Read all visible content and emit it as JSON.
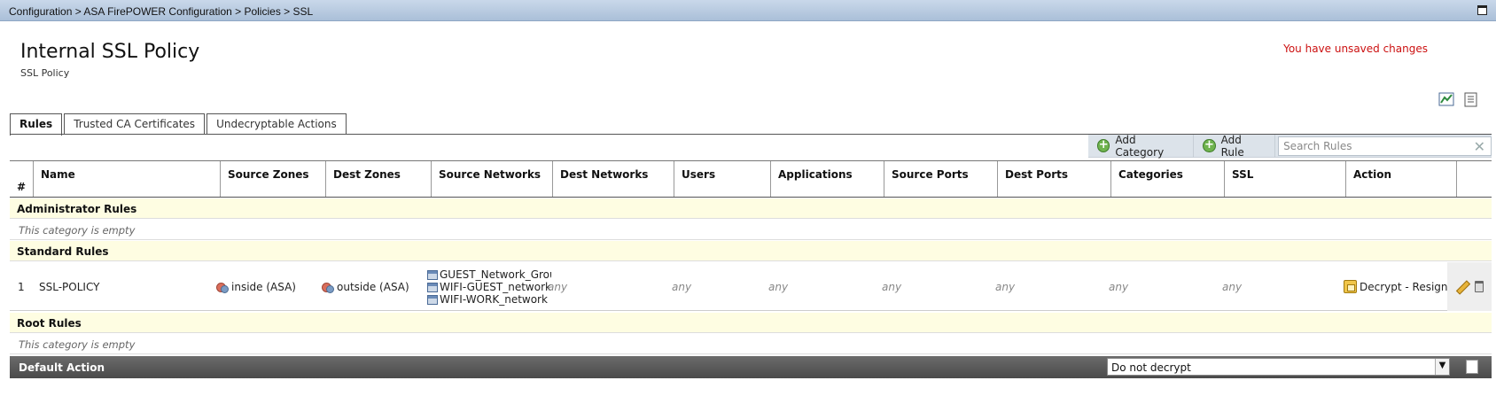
{
  "breadcrumb": "Configuration > ASA FirePOWER Configuration > Policies > SSL",
  "policy": {
    "title": "Internal SSL Policy",
    "subtitle": "SSL Policy",
    "unsaved_message": "You have unsaved changes"
  },
  "tabs": [
    {
      "label": "Rules",
      "active": true
    },
    {
      "label": "Trusted CA Certificates",
      "active": false
    },
    {
      "label": "Undecryptable Actions",
      "active": false
    }
  ],
  "toolbar": {
    "add_category": "Add Category",
    "add_rule": "Add Rule",
    "search_placeholder": "Search Rules"
  },
  "columns": [
    "#",
    "Name",
    "Source Zones",
    "Dest Zones",
    "Source Networks",
    "Dest Networks",
    "Users",
    "Applications",
    "Source Ports",
    "Dest Ports",
    "Categories",
    "SSL",
    "Action"
  ],
  "categories": {
    "administrator": {
      "label": "Administrator Rules",
      "empty_text": "This category is empty"
    },
    "standard": {
      "label": "Standard Rules"
    },
    "root": {
      "label": "Root Rules",
      "empty_text": "This category is empty"
    }
  },
  "rule": {
    "number": "1",
    "name": "SSL-POLICY",
    "source_zone": "inside (ASA)",
    "dest_zone": "outside (ASA)",
    "source_networks": [
      "GUEST_Network_Grou",
      "WIFI-GUEST_network",
      "WIFI-WORK_network"
    ],
    "dest_networks": "any",
    "users": "any",
    "applications": "any",
    "source_ports": "any",
    "dest_ports": "any",
    "categories": "any",
    "ssl": "any",
    "action": "Decrypt - Resign"
  },
  "default_action": {
    "label": "Default Action",
    "selected": "Do not decrypt"
  },
  "colors": {
    "breadcrumb_bg": "#b8cbe0",
    "category_bg": "#fefde2",
    "unsaved": "#cc1111",
    "default_bar": "#4f4f4f"
  }
}
